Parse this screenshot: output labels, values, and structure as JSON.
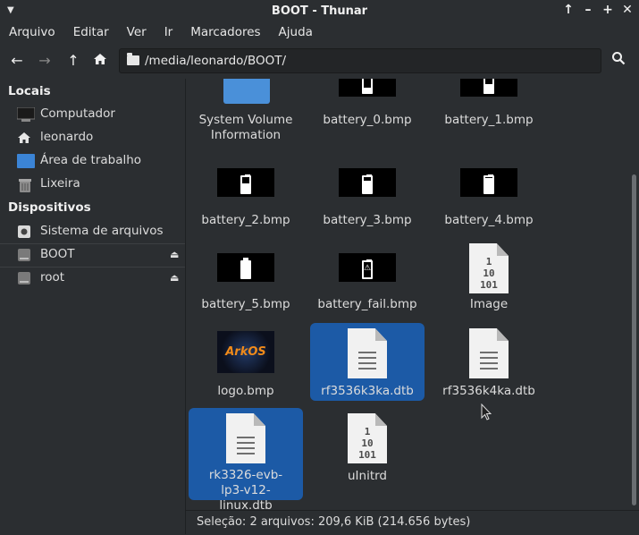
{
  "window": {
    "title": "BOOT - Thunar"
  },
  "menu": [
    "Arquivo",
    "Editar",
    "Ver",
    "Ir",
    "Marcadores",
    "Ajuda"
  ],
  "toolbar": {
    "path": "/media/leonardo/BOOT/"
  },
  "sidebar": {
    "places_header": "Locais",
    "places": [
      "Computador",
      "leonardo",
      "Área de trabalho",
      "Lixeira"
    ],
    "devices_header": "Dispositivos",
    "devices": [
      "Sistema de arquivos",
      "BOOT",
      "root"
    ]
  },
  "files": [
    {
      "name": "System Volume Information",
      "type": "folder",
      "selected": false
    },
    {
      "name": "battery_0.bmp",
      "type": "bmp",
      "level": 0.1,
      "selected": false
    },
    {
      "name": "battery_1.bmp",
      "type": "bmp",
      "level": 0.3,
      "selected": false
    },
    {
      "name": "battery_2.bmp",
      "type": "bmp",
      "level": 0.5,
      "selected": false
    },
    {
      "name": "battery_3.bmp",
      "type": "bmp",
      "level": 0.65,
      "selected": false
    },
    {
      "name": "battery_4.bmp",
      "type": "bmp",
      "level": 0.85,
      "selected": false
    },
    {
      "name": "battery_5.bmp",
      "type": "bmp",
      "level": 1.0,
      "selected": false
    },
    {
      "name": "battery_fail.bmp",
      "type": "bmp-fail",
      "selected": false
    },
    {
      "name": "Image",
      "type": "binary",
      "selected": false
    },
    {
      "name": "logo.bmp",
      "type": "logo",
      "logo_text": "ArkOS",
      "selected": false
    },
    {
      "name": "rf3536k3ka.dtb",
      "type": "text",
      "selected": true
    },
    {
      "name": "rf3536k4ka.dtb",
      "type": "text",
      "selected": false
    },
    {
      "name": "rk3326-evb-lp3-v12-linux.dtb",
      "type": "text",
      "selected": true
    },
    {
      "name": "uInitrd",
      "type": "binary",
      "selected": false
    }
  ],
  "status": {
    "text": "Seleção: 2 arquivos: 209,6 KiB (214.656 bytes)"
  },
  "colors": {
    "selection": "#1c5aa6",
    "background": "#2b2e31",
    "folder": "#4a90d9"
  }
}
